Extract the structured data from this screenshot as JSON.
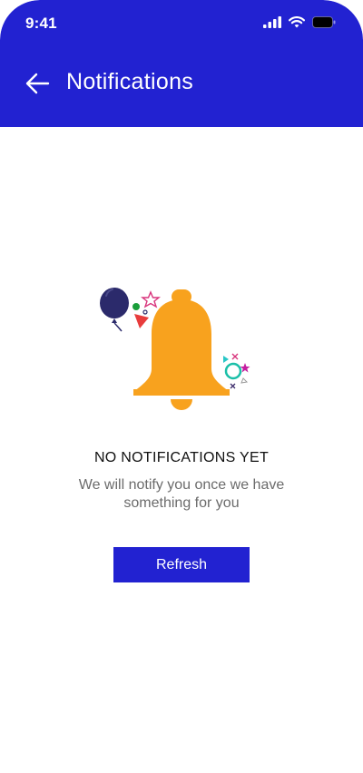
{
  "status_bar": {
    "time": "9:41",
    "icons": [
      "cellular-signal-icon",
      "wifi-icon",
      "battery-icon"
    ]
  },
  "header": {
    "back_icon": "arrow-left-icon",
    "title": "Notifications"
  },
  "empty_state": {
    "illustration": "bell-with-balloon-and-confetti",
    "title": "NO NOTIFICATIONS YET",
    "message": "We will notify you once we have something for you",
    "refresh_label": "Refresh"
  },
  "colors": {
    "primary": "#2222d1",
    "bell": "#f8a21e",
    "balloon": "#2b2a6b",
    "text_primary": "#111111",
    "text_secondary": "#6b6b6b"
  }
}
